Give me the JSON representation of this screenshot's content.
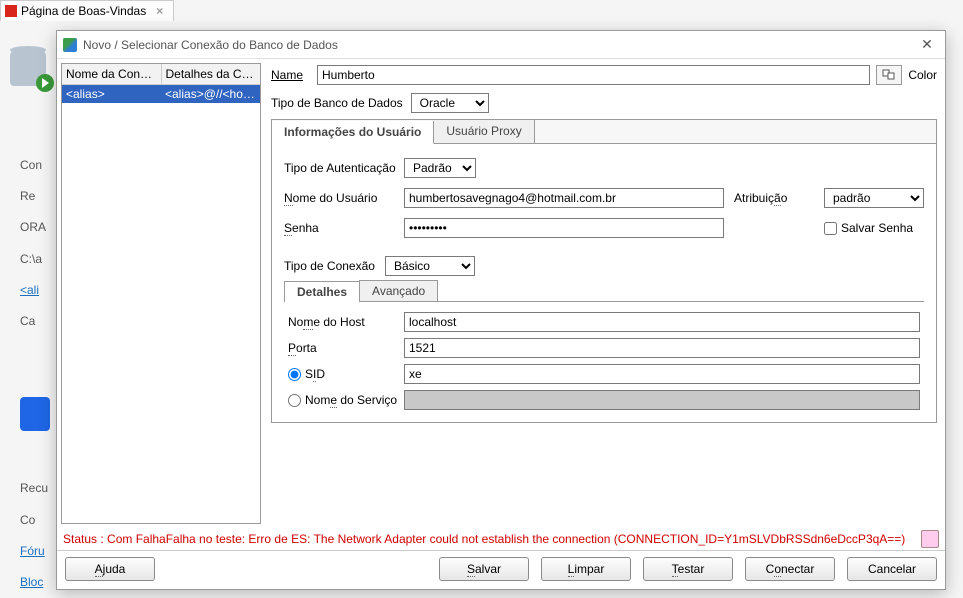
{
  "bg": {
    "tab_title": "Página de Boas-Vindas",
    "left_panel": {
      "con": "Con",
      "re": "Re",
      "ora": "ORA",
      "path": "C:\\a",
      "alias": "<ali",
      "ca": "Ca",
      "recu": "Recu",
      "co": "Co",
      "foru": "Fóru",
      "bloc": "Bloc"
    }
  },
  "dialog": {
    "title": "Novo / Selecionar Conexão do Banco de Dados",
    "list": {
      "header_name": "Nome da Conexão",
      "header_details": "Detalhes da Con...",
      "row_name": "<alias>",
      "row_details": "<alias>@//<host..."
    },
    "name_label": "Name",
    "name_value": "Humberto",
    "color_label": "Color",
    "dbtype_label": "Tipo de Banco de Dados",
    "dbtype_value": "Oracle",
    "tab_user": "Informações do Usuário",
    "tab_proxy": "Usuário Proxy",
    "auth_label": "Tipo de Autenticação",
    "auth_value": "Padrão",
    "username_label": "Nome do Usuário",
    "username_value": "humbertosavegnago4@hotmail.com.br",
    "password_label": "Senha",
    "password_value": "•••••••••",
    "role_label": "Atribuição",
    "role_value": "padrão",
    "save_pw": "Salvar Senha",
    "conn_type_label": "Tipo de Conexão",
    "conn_type_value": "Básico",
    "subtab_details": "Detalhes",
    "subtab_advanced": "Avançado",
    "host_label": "Nome do Host",
    "host_value": "localhost",
    "port_label": "Porta",
    "port_value": "1521",
    "sid_label": "SID",
    "sid_value": "xe",
    "service_label": "Nome do Serviço",
    "service_value": "",
    "status": "Status : Com FalhaFalha no teste: Erro de ES: The Network Adapter could not establish the connection (CONNECTION_ID=Y1mSLVDbRSSdn6eDccP3qA==)",
    "buttons": {
      "help": "Ajuda",
      "save": "Salvar",
      "clear": "Limpar",
      "test": "Testar",
      "connect": "Conectar",
      "cancel": "Cancelar"
    }
  }
}
